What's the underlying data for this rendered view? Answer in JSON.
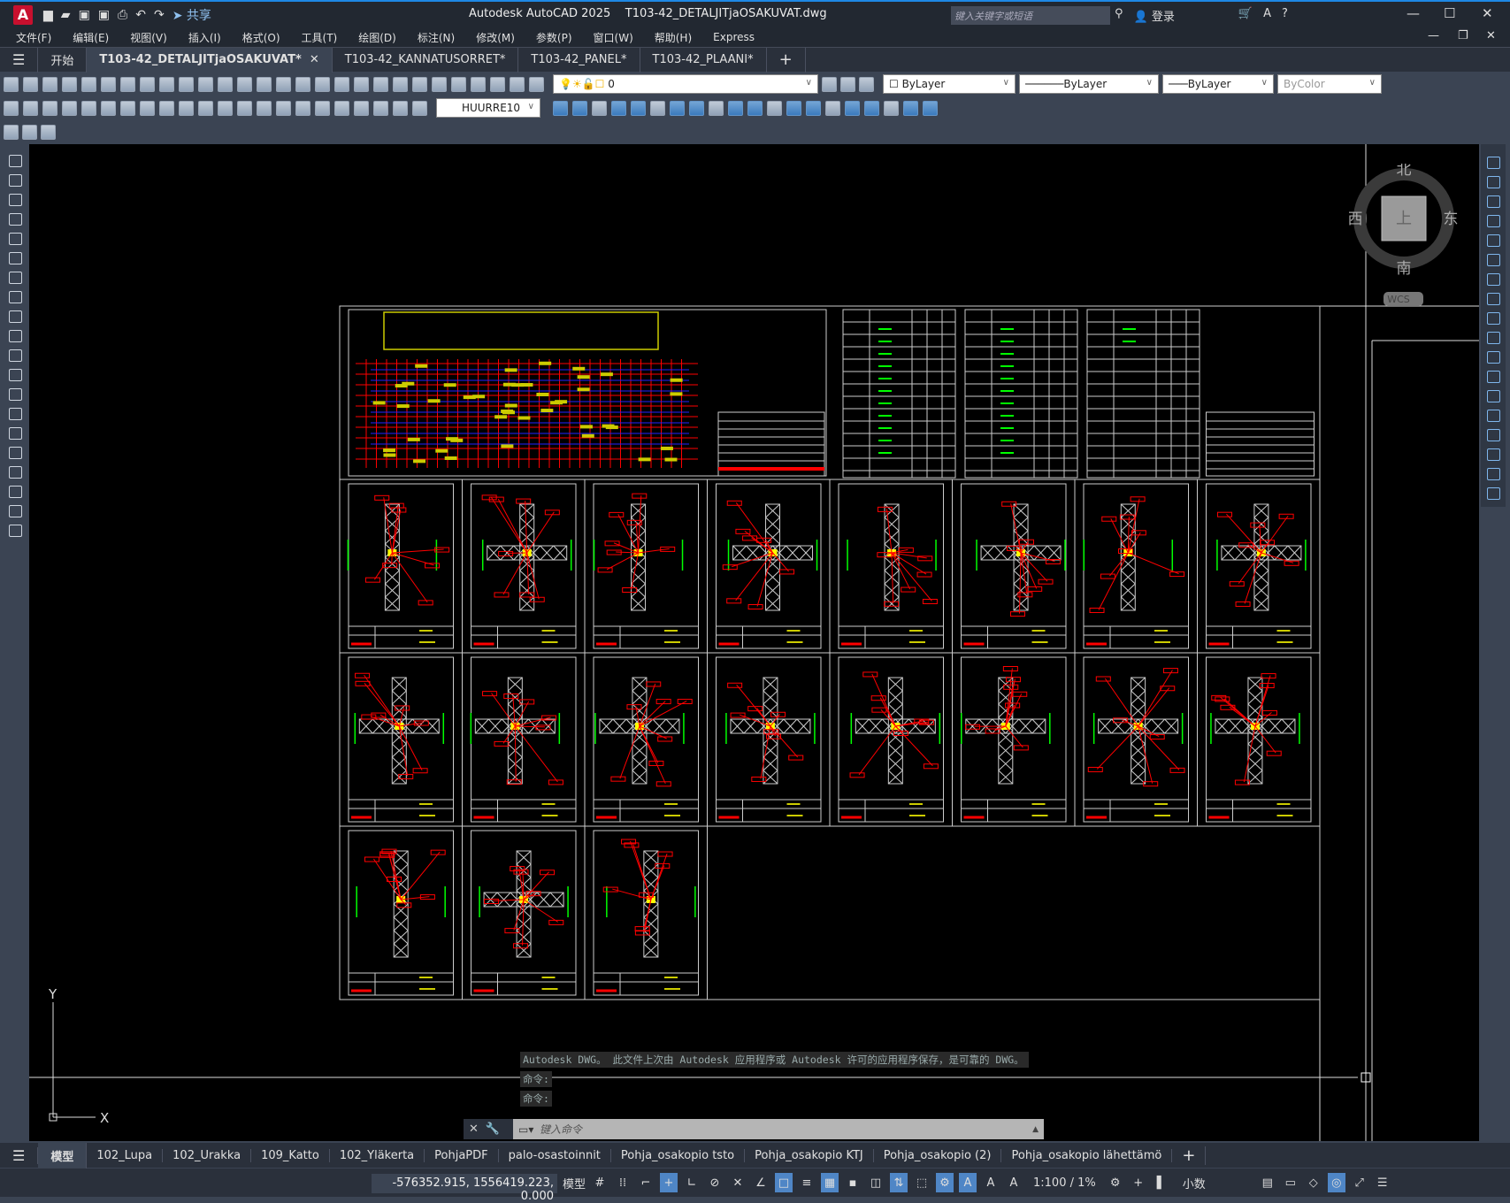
{
  "app": {
    "title": "Autodesk AutoCAD 2025",
    "file": "T103-42_DETALJITjaOSAKUVAT.dwg",
    "share": "共享",
    "search_placeholder": "键入关键字或短语",
    "login": "登录"
  },
  "menu": [
    "文件(F)",
    "编辑(E)",
    "视图(V)",
    "插入(I)",
    "格式(O)",
    "工具(T)",
    "绘图(D)",
    "标注(N)",
    "修改(M)",
    "参数(P)",
    "窗口(W)",
    "帮助(H)",
    "Express"
  ],
  "doc_tabs": {
    "start": "开始",
    "tabs": [
      "T103-42_DETALJITjaOSAKUVAT*",
      "T103-42_KANNATUSORRET*",
      "T103-42_PANEL*",
      "T103-42_PLAANI*"
    ],
    "active": 0
  },
  "toolbar": {
    "layer": "0",
    "color": "ByLayer",
    "linetype": "ByLayer",
    "lineweight": "ByLayer",
    "plotstyle": "ByColor",
    "dimstyle": "HUURRE10"
  },
  "viewcube": {
    "north": "北",
    "south": "南",
    "east": "东",
    "west": "西",
    "face": "上",
    "ucs": "WCS"
  },
  "ucs_icon": {
    "x": "X",
    "y": "Y"
  },
  "command": {
    "history": [
      "Autodesk DWG。  此文件上次由 Autodesk 应用程序或 Autodesk 许可的应用程序保存，是可靠的 DWG。",
      "命令:",
      "命令:"
    ],
    "placeholder": "键入命令"
  },
  "layout_tabs": [
    "模型",
    "102_Lupa",
    "102_Urakka",
    "109_Katto",
    "102_Yläkerta",
    "PohjaPDF",
    "palo-osastoinnit",
    "Pohja_osakopio tsto",
    "Pohja_osakopio KTJ",
    "Pohja_osakopio (2)",
    "Pohja_osakopio lähettämö"
  ],
  "status": {
    "coords": "-576352.915, 1556419.223, 0.000",
    "space": "模型",
    "scale": "1:100 / 1%",
    "units": "小数"
  },
  "drawing_colors": {
    "frame": "#ffffff",
    "annotation": "#ff0000",
    "dimension": "#00ff00",
    "highlight": "#ffff00",
    "grid_blue": "#0000ff"
  }
}
